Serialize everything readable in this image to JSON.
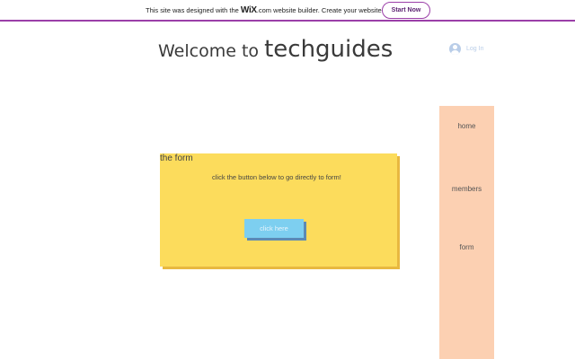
{
  "banner": {
    "text_before": "This site was designed with the ",
    "logo": "WiX",
    "logo_suffix": ".com",
    "text_after": " website builder. Create your website today.",
    "cta_label": "Start Now"
  },
  "header": {
    "title_prefix": "Welcome to ",
    "title_name": "techguides",
    "login_label": "Log In"
  },
  "sidebar": {
    "items": [
      {
        "label": "home"
      },
      {
        "label": "members"
      },
      {
        "label": "form"
      }
    ]
  },
  "form_card": {
    "title": "the form",
    "description": "click the button below to go directly to form!",
    "button_label": "click here"
  },
  "colors": {
    "banner_accent": "#9b3fa8",
    "sidebar_bg": "#fcd0b2",
    "card_bg": "#fcdc5c",
    "button_bg": "#7dcff0"
  }
}
